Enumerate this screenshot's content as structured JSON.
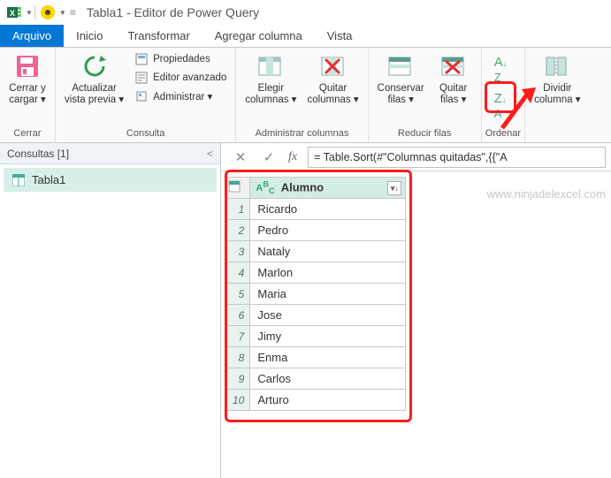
{
  "title": "Tabla1 - Editor de Power Query",
  "tabs": {
    "file": "Arquivo",
    "home": "Inicio",
    "transform": "Transformar",
    "addcol": "Agregar columna",
    "view": "Vista"
  },
  "ribbon": {
    "close": {
      "l1": "Cerrar y",
      "l2": "cargar ▾",
      "group": "Cerrar"
    },
    "consult": {
      "refresh": {
        "l1": "Actualizar",
        "l2": "vista previa ▾"
      },
      "props": "Propiedades",
      "advanced": "Editor avanzado",
      "manage": "Administrar ▾",
      "group": "Consulta"
    },
    "cols": {
      "choose": {
        "l1": "Elegir",
        "l2": "columnas ▾"
      },
      "remove": {
        "l1": "Quitar",
        "l2": "columnas ▾"
      },
      "group": "Administrar columnas"
    },
    "rows": {
      "keep": {
        "l1": "Conservar",
        "l2": "filas ▾"
      },
      "remove": {
        "l1": "Quitar",
        "l2": "filas ▾"
      },
      "group": "Reducir filas"
    },
    "sort": {
      "group": "Ordenar"
    },
    "split": {
      "l1": "Dividir",
      "l2": "columna ▾"
    }
  },
  "queries": {
    "header": "Consultas [1]",
    "item": "Tabla1"
  },
  "formula": "= Table.Sort(#\"Columnas quitadas\",{{\"A",
  "grid": {
    "col": "Alumno",
    "rows": [
      "Ricardo",
      "Pedro",
      "Nataly",
      "Marlon",
      "Maria",
      "Jose",
      "Jimy",
      "Enma",
      "Carlos",
      "Arturo"
    ]
  },
  "watermark": "www.ninjadelexcel.com"
}
